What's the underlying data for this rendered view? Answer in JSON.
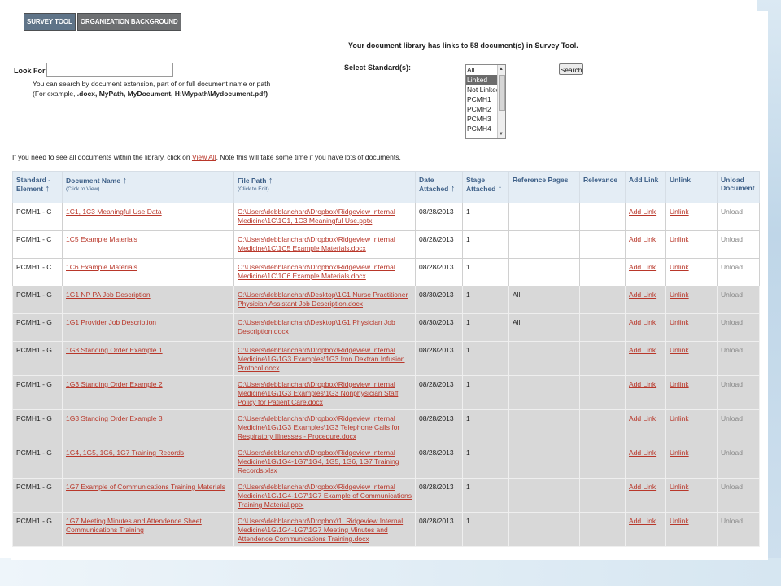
{
  "tabs": [
    "SURVEY TOOL",
    "ORGANIZATION BACKGROUND"
  ],
  "summary": "Your document library has links to 58 document(s) in Survey Tool.",
  "search": {
    "look_for_label": "Look For:",
    "value": "",
    "hint_line1": "You can search by document extension, part of or full document name or path",
    "hint_prefix": "(For example, ",
    "hint_example": ".docx, MyPath, MyDocument, H:\\Mypath\\Mydocument.pdf)",
    "select_label": "Select Standard(s):",
    "options": [
      "All",
      "Linked",
      "Not Linked",
      "PCMH1",
      "PCMH2",
      "PCMH3",
      "PCMH4"
    ],
    "selected": "Linked",
    "button_label": "Search"
  },
  "view_all": {
    "before": "If you need to see all documents within the library, click on ",
    "link": "View All",
    "after": ". Note this will take some time if you have lots of documents."
  },
  "columns": {
    "standard": "Standard - Element",
    "docname": "Document Name",
    "docname_sub": "(Click to View)",
    "filepath": "File Path",
    "filepath_sub": "(Click to Edit)",
    "date": "Date Attached",
    "stage": "Stage Attached",
    "refpages": "Reference Pages",
    "relevance": "Relevance",
    "addlink": "Add Link",
    "unlink": "Unlink",
    "unload": "Unload Document"
  },
  "rows": [
    {
      "standard": "PCMH1 - C",
      "name": "1C1, 1C3 Meaningful Use Data",
      "path": "C:\\Users\\debblanchard\\Dropbox\\Ridgeview Internal Medicine\\1C\\1C1, 1C3 Meaningful Use.pptx",
      "date": "08/28/2013",
      "stage": "1",
      "refpages": "",
      "relevance": "",
      "add": "Add Link",
      "unlink": "Unlink",
      "unload": "Unload",
      "shade": "white"
    },
    {
      "standard": "PCMH1 - C",
      "name": "1C5 Example Materials",
      "path": "C:\\Users\\debblanchard\\Dropbox\\Ridgeview Internal Medicine\\1C\\1C5 Example Materials.docx",
      "date": "08/28/2013",
      "stage": "1",
      "refpages": "",
      "relevance": "",
      "add": "Add Link",
      "unlink": "Unlink",
      "unload": "Unload",
      "shade": "white"
    },
    {
      "standard": "PCMH1 - C",
      "name": "1C6 Example Materials",
      "path": "C:\\Users\\debblanchard\\Dropbox\\Ridgeview Internal Medicine\\1C\\1C6 Example Materials.docx",
      "date": "08/28/2013",
      "stage": "1",
      "refpages": "",
      "relevance": "",
      "add": "Add Link",
      "unlink": "Unlink",
      "unload": "Unload",
      "shade": "white"
    },
    {
      "standard": "PCMH1 - G",
      "name": "1G1 NP PA Job Description",
      "path": "C:\\Users\\debblanchard\\Desktop\\1G1 Nurse Practitioner Physician Assistant Job Description.docx",
      "date": "08/30/2013",
      "stage": "1",
      "refpages": "All",
      "relevance": "",
      "add": "Add Link",
      "unlink": "Unlink",
      "unload": "Unload",
      "shade": "gray"
    },
    {
      "standard": "PCMH1 - G",
      "name": "1G1 Provider Job Description",
      "path": "C:\\Users\\debblanchard\\Desktop\\1G1 Physician Job Description.docx",
      "date": "08/30/2013",
      "stage": "1",
      "refpages": "All",
      "relevance": "",
      "add": "Add Link",
      "unlink": "Unlink",
      "unload": "Unload",
      "shade": "gray"
    },
    {
      "standard": "PCMH1 - G",
      "name": "1G3 Standing Order Example 1",
      "path": "C:\\Users\\debblanchard\\Dropbox\\Ridgeview Internal Medicine\\1G\\1G3 Examples\\1G3 Iron Dextran Infusion Protocol.docx",
      "date": "08/28/2013",
      "stage": "1",
      "refpages": "",
      "relevance": "",
      "add": "Add Link",
      "unlink": "Unlink",
      "unload": "Unload",
      "shade": "gray"
    },
    {
      "standard": "PCMH1 - G",
      "name": "1G3 Standing Order Example 2",
      "path": "C:\\Users\\debblanchard\\Dropbox\\Ridgeview Internal Medicine\\1G\\1G3 Examples\\1G3 Nonphysician Staff Policy for Patient Care.docx",
      "date": "08/28/2013",
      "stage": "1",
      "refpages": "",
      "relevance": "",
      "add": "Add Link",
      "unlink": "Unlink",
      "unload": "Unload",
      "shade": "gray"
    },
    {
      "standard": "PCMH1 - G",
      "name": "1G3 Standing Order Example 3",
      "path": "C:\\Users\\debblanchard\\Dropbox\\Ridgeview Internal Medicine\\1G\\1G3 Examples\\1G3 Telephone Calls for Respiratory Illnesses - Procedure.docx",
      "date": "08/28/2013",
      "stage": "1",
      "refpages": "",
      "relevance": "",
      "add": "Add Link",
      "unlink": "Unlink",
      "unload": "Unload",
      "shade": "gray"
    },
    {
      "standard": "PCMH1 - G",
      "name": "1G4, 1G5, 1G6, 1G7 Training Records",
      "path": "C:\\Users\\debblanchard\\Dropbox\\Ridgeview Internal Medicine\\1G\\1G4-1G7\\1G4, 1G5, 1G6, 1G7 Training Records.xlsx",
      "date": "08/28/2013",
      "stage": "1",
      "refpages": "",
      "relevance": "",
      "add": "Add Link",
      "unlink": "Unlink",
      "unload": "Unload",
      "shade": "gray"
    },
    {
      "standard": "PCMH1 - G",
      "name": "1G7 Example of Communications Training Materials",
      "path": "C:\\Users\\debblanchard\\Dropbox\\Ridgeview Internal Medicine\\1G\\1G4-1G7\\1G7 Example of Communications Training Material.pptx",
      "date": "08/28/2013",
      "stage": "1",
      "refpages": "",
      "relevance": "",
      "add": "Add Link",
      "unlink": "Unlink",
      "unload": "Unload",
      "shade": "gray"
    },
    {
      "standard": "PCMH1 - G",
      "name": "1G7 Meeting Minutes and Attendence Sheet Communications Training",
      "path": "C:\\Users\\debblanchard\\Dropbox\\1. Ridgeview Internal Medicine\\1G\\1G4-1G7\\1G7 Meeting Minutes and Attendence Communications Training.docx",
      "date": "08/28/2013",
      "stage": "1",
      "refpages": "",
      "relevance": "",
      "add": "Add Link",
      "unlink": "Unlink",
      "unload": "Unload",
      "shade": "gray"
    }
  ]
}
